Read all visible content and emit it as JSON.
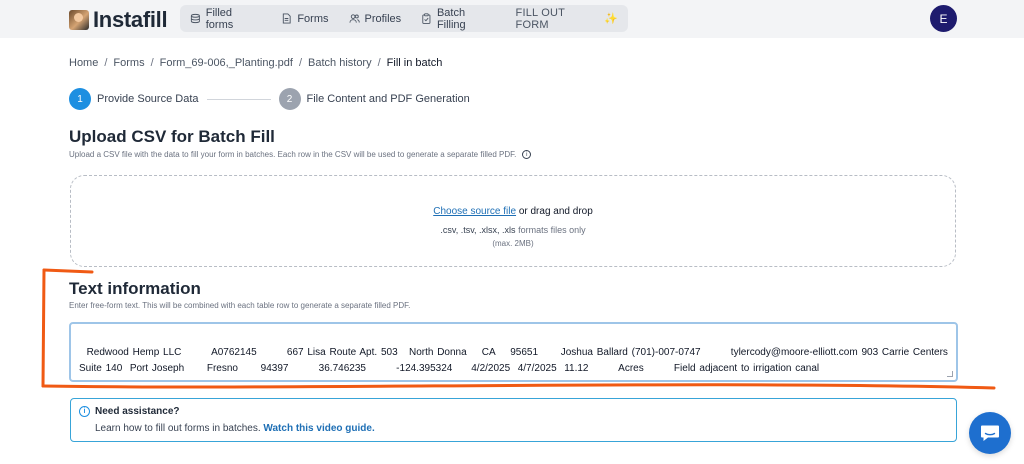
{
  "header": {
    "app_name": "Instafill",
    "nav": [
      {
        "label": "Filled forms",
        "icon": "database-icon"
      },
      {
        "label": "Forms",
        "icon": "document-icon"
      },
      {
        "label": "Profiles",
        "icon": "users-icon"
      },
      {
        "label": "Batch Filling",
        "icon": "clipboard-icon"
      }
    ],
    "cta_label": "FILL OUT FORM",
    "cta_icon": "✨",
    "avatar_initial": "E"
  },
  "breadcrumb": {
    "items": [
      "Home",
      "Forms",
      "Form_69-006,_Planting.pdf",
      "Batch history",
      "Fill in batch"
    ],
    "separator": "/"
  },
  "stepper": {
    "steps": [
      {
        "number": "1",
        "label": "Provide Source Data",
        "active": true
      },
      {
        "number": "2",
        "label": "File Content and PDF Generation",
        "active": false
      }
    ]
  },
  "upload": {
    "title": "Upload CSV for Batch Fill",
    "subtitle": "Upload a CSV file with the data to fill your form in batches. Each row in the CSV will be used to generate a separate filled PDF.",
    "info_glyph": "i",
    "choose_link": "Choose source file",
    "or_text": "or drag and drop",
    "extensions": ".csv, .tsv, .xlsx, .xls",
    "formats_text": "formats files only",
    "max_size": "(max. 2MB)"
  },
  "text_info": {
    "title": "Text information",
    "subtitle": "Enter free-form text. This will be combined with each table row to generate a separate filled PDF.",
    "value": "Redwood Hemp LLC        A0762145        667 Lisa Route Apt. 503   North Donna    CA    95651      Joshua Ballard (701)-007-0747        tylercody@moore-elliott.com 903 Carrie Centers Suite 140  Port Joseph      Fresno      94397        36.746235        -124.395324     4/2/2025  4/7/2025  11.12        Acres        Field adjacent to irrigation canal"
  },
  "assist": {
    "icon_glyph": "i",
    "title": "Need assistance?",
    "body": "Learn how to fill out forms in batches.",
    "link": "Watch this video guide."
  },
  "colors": {
    "accent": "#1d8fe1",
    "annotation": "#f05a14",
    "avatar_bg": "#1e1b6e",
    "chat_bg": "#1e6fcf"
  }
}
